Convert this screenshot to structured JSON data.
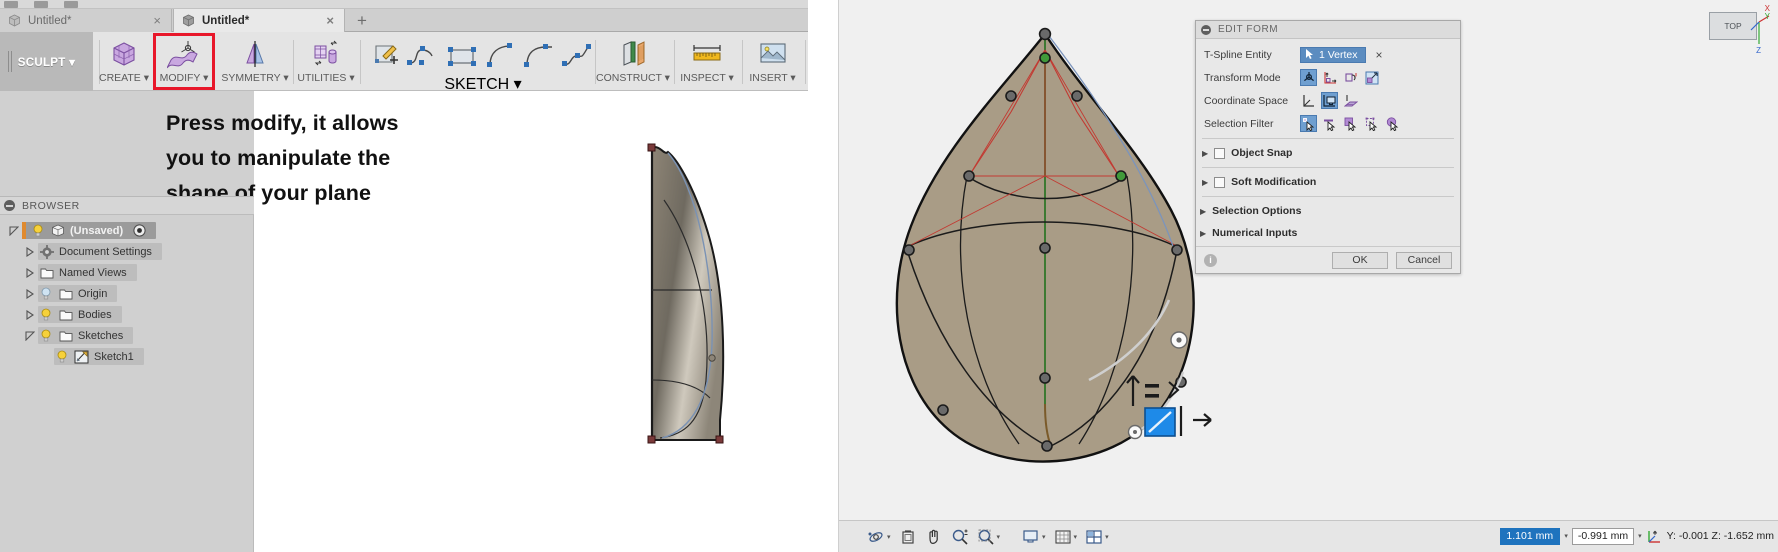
{
  "app": {
    "tabs": [
      {
        "label": "Untitled*",
        "active": false,
        "icon": "cube-icon",
        "close": "×"
      },
      {
        "label": "Untitled*",
        "active": true,
        "icon": "cube-icon",
        "close": "×"
      }
    ],
    "new_tab": "+"
  },
  "ribbon": {
    "workspace": "SCULPT",
    "workspace_caret": "▾",
    "groups": [
      {
        "name": "CREATE",
        "label": "CREATE ▾",
        "icon": "create-box-icon"
      },
      {
        "name": "MODIFY",
        "label": "MODIFY ▾",
        "icon": "modify-surface-icon",
        "highlighted": true
      },
      {
        "name": "SYMMETRY",
        "label": "SYMMETRY ▾",
        "icon": "symmetry-mirror-icon"
      },
      {
        "name": "UTILITIES",
        "label": "UTILITIES ▾",
        "icon": "utilities-convert-icon"
      },
      {
        "name": "SKETCH",
        "label": "SKETCH ▾",
        "icon": "sketch-tools-icon"
      },
      {
        "name": "CONSTRUCT",
        "label": "CONSTRUCT ▾",
        "icon": "construct-plane-icon"
      },
      {
        "name": "INSPECT",
        "label": "INSPECT ▾",
        "icon": "inspect-measure-icon"
      },
      {
        "name": "INSERT",
        "label": "INSERT ▾",
        "icon": "insert-image-icon"
      }
    ]
  },
  "annotation": {
    "lines": [
      "Press modify, it allows",
      "you to manipulate the",
      "shape of your plane"
    ],
    "highlight_color": "#e8172a"
  },
  "browser": {
    "title": "BROWSER",
    "tree": [
      {
        "label": "(Unsaved)",
        "depth": 0,
        "expanded": true,
        "bulb": "on",
        "icon": "cube-icon",
        "selected": true,
        "eye": true
      },
      {
        "label": "Document Settings",
        "depth": 1,
        "expanded": false,
        "bulb": "none",
        "icon": "gear-icon"
      },
      {
        "label": "Named Views",
        "depth": 1,
        "expanded": false,
        "bulb": "none",
        "icon": "folder-icon"
      },
      {
        "label": "Origin",
        "depth": 1,
        "expanded": false,
        "bulb": "off",
        "icon": "folder-icon"
      },
      {
        "label": "Bodies",
        "depth": 1,
        "expanded": false,
        "bulb": "on",
        "icon": "folder-icon"
      },
      {
        "label": "Sketches",
        "depth": 1,
        "expanded": true,
        "bulb": "on",
        "icon": "folder-icon"
      },
      {
        "label": "Sketch1",
        "depth": 2,
        "expanded": false,
        "bulb": "on",
        "icon": "sketch-icon"
      }
    ]
  },
  "dialog": {
    "title": "EDIT FORM",
    "rows": [
      {
        "label": "T-Spline Entity",
        "type": "selection",
        "value": "1 Vertex",
        "clear": "×"
      },
      {
        "label": "Transform Mode",
        "type": "iconset",
        "active_index": 0,
        "icons": [
          "transform-freeform-icon",
          "transform-translate-icon",
          "transform-rotate-icon",
          "transform-scale-icon"
        ]
      },
      {
        "label": "Coordinate Space",
        "type": "iconset",
        "active_index": 1,
        "icons": [
          "space-world-icon",
          "space-view-icon",
          "space-surface-icon"
        ]
      },
      {
        "label": "Selection Filter",
        "type": "iconset",
        "active_index": 0,
        "icons": [
          "filter-vertex-icon",
          "filter-edge-icon",
          "filter-face-icon",
          "filter-body-icon",
          "filter-all-icon"
        ]
      }
    ],
    "collapsibles": [
      {
        "label": "Object Snap",
        "checkbox": true,
        "checked": false,
        "tri": "▶"
      },
      {
        "label": "Soft Modification",
        "checkbox": true,
        "checked": false,
        "tri": "▶"
      },
      {
        "label": "Selection Options",
        "checkbox": false,
        "tri": "▶"
      },
      {
        "label": "Numerical Inputs",
        "checkbox": false,
        "tri": "▶"
      }
    ],
    "footer": {
      "info": "i",
      "ok": "OK",
      "cancel": "Cancel"
    }
  },
  "viewcube": {
    "face_label": "TOP",
    "axis_x": "X",
    "axis_y": "Y",
    "axis_z": "Z"
  },
  "navbar": {
    "buttons": [
      {
        "name": "orbit-icon",
        "caret": "▾"
      },
      {
        "name": "look-at-icon",
        "caret": ""
      },
      {
        "name": "pan-hand-icon",
        "caret": ""
      },
      {
        "name": "zoom-icon",
        "caret": ""
      },
      {
        "name": "zoom-window-icon",
        "caret": "▾"
      },
      {
        "name": "display-settings-icon",
        "caret": "▾"
      },
      {
        "name": "grid-snap-icon",
        "caret": "▾"
      },
      {
        "name": "viewports-icon",
        "caret": "▾"
      }
    ]
  },
  "status": {
    "field_primary": "1.101 mm",
    "field_secondary": "-0.991 mm",
    "caret": "▾",
    "coords": "Y: -0.001 Z: -1.652 mm",
    "coords_axis_icon": "axis-tripod-icon"
  },
  "colors": {
    "accent_blue": "#5b8cc0",
    "active_blue": "#1e73be",
    "highlight_red": "#e8172a",
    "model_tan": "#a99c86",
    "ribbon_bg": "#e4e4e4",
    "panel_bg": "#d0d0d0"
  }
}
